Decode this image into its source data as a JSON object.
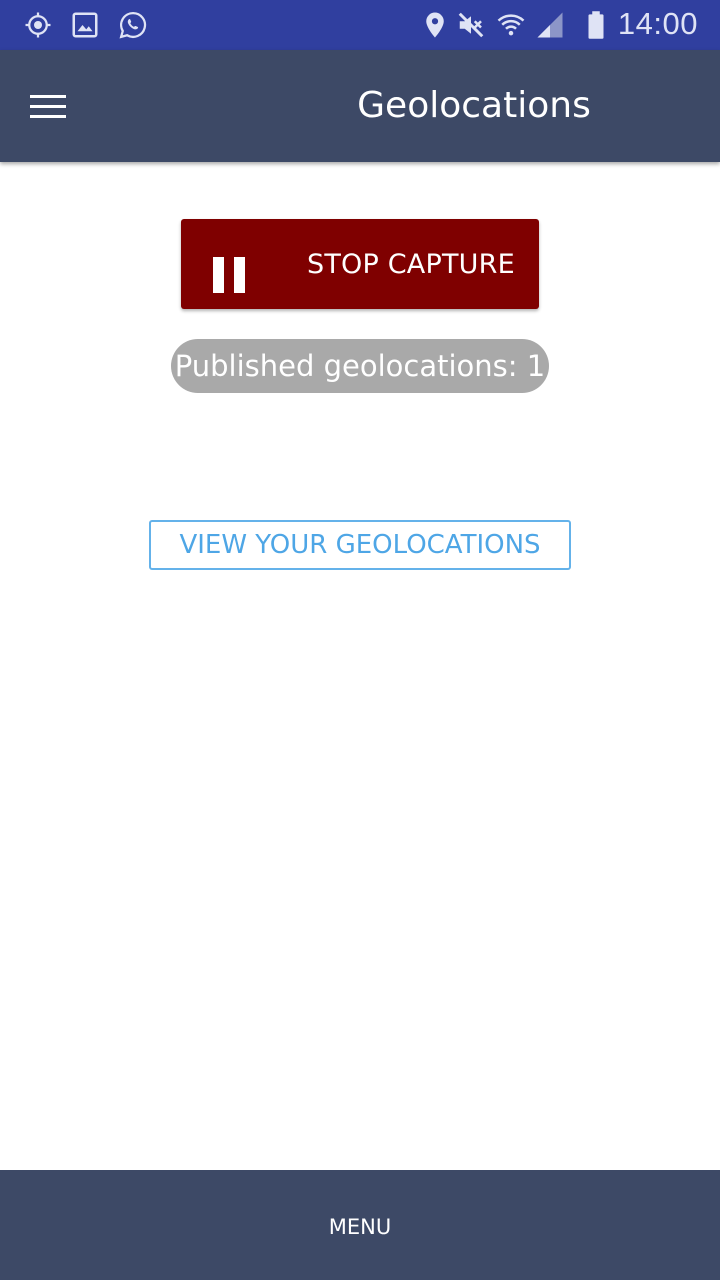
{
  "status_bar": {
    "time": "14:00",
    "left_icons": [
      "gps-icon",
      "image-icon",
      "whatsapp-icon"
    ],
    "right_icons": [
      "location-pin-icon",
      "mute-icon",
      "wifi-icon",
      "signal-icon",
      "battery-icon"
    ],
    "background": "#303f9f"
  },
  "app_bar": {
    "title": "Geolocations",
    "menu_icon": "hamburger-menu-icon",
    "background": "#3d4966"
  },
  "main": {
    "capture_button": {
      "label": "STOP CAPTURE",
      "icon": "pause-icon",
      "background": "#7f0000"
    },
    "published_badge": {
      "text": "Published geolocations: 1",
      "background": "#a9a9a9"
    },
    "view_button": {
      "label": "VIEW YOUR GEOLOCATIONS",
      "color": "#4ea6e6"
    }
  },
  "bottom_bar": {
    "label": "MENU",
    "background": "#3d4966"
  }
}
